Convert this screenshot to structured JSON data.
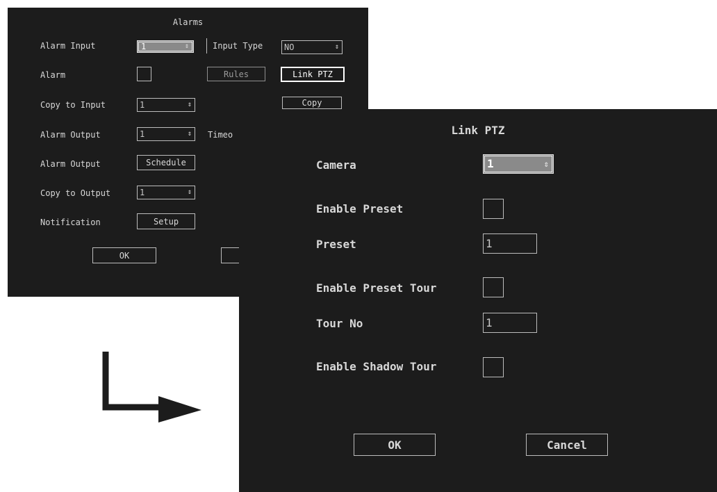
{
  "alarms": {
    "title": "Alarms",
    "alarm_input_label": "Alarm Input",
    "alarm_input_value": "1",
    "input_type_label": "Input Type",
    "input_type_value": "NO",
    "alarm_label": "Alarm",
    "rules_label": "Rules",
    "link_ptz_label": "Link PTZ",
    "copy_to_input_label": "Copy to Input",
    "copy_to_input_value": "1",
    "copy_label": "Copy",
    "alarm_output_label": "Alarm Output",
    "alarm_output_value": "1",
    "timeout_label": "Timeo",
    "alarm_output_schedule_label": "Alarm Output",
    "schedule_label": "Schedule",
    "copy_to_output_label": "Copy to Output",
    "copy_to_output_value": "1",
    "notification_label": "Notification",
    "setup_label": "Setup",
    "ok_label": "OK"
  },
  "link_ptz": {
    "title": "Link PTZ",
    "camera_label": "Camera",
    "camera_value": "1",
    "enable_preset_label": "Enable Preset",
    "preset_label": "Preset",
    "preset_value": "1",
    "enable_preset_tour_label": "Enable Preset Tour",
    "tour_no_label": "Tour No",
    "tour_no_value": "1",
    "enable_shadow_tour_label": "Enable Shadow Tour",
    "ok_label": "OK",
    "cancel_label": "Cancel"
  },
  "icons": {
    "spinner": "up-down-arrows-icon",
    "flow": "right-angle-arrow-icon"
  },
  "colors": {
    "panel_bg": "#1c1c1c",
    "page_bg": "#ffffff",
    "text": "#d8d8d8",
    "arrow": "#1c1c1c"
  }
}
